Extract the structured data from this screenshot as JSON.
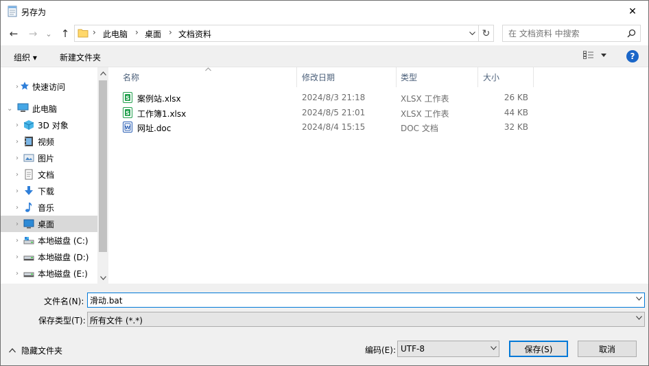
{
  "window": {
    "title": "另存为",
    "close_glyph": "✕"
  },
  "nav": {
    "back_glyph": "←",
    "forward_glyph": "→",
    "recent_glyph": "⌄",
    "up_glyph": "↑",
    "breadcrumb": [
      "此电脑",
      "桌面",
      "文档资料"
    ],
    "breadcrumb_sep": "›",
    "refresh_glyph": "↻",
    "search_placeholder": "在 文档资料 中搜索"
  },
  "toolbar": {
    "organize": "组织 ▾",
    "new_folder": "新建文件夹",
    "help": "?"
  },
  "sidebar": {
    "items": [
      {
        "label": "快速访问",
        "icon": "star-icon"
      },
      {
        "label": "此电脑",
        "icon": "pc-icon"
      },
      {
        "label": "3D 对象",
        "icon": "3d-objects-icon"
      },
      {
        "label": "视频",
        "icon": "video-icon"
      },
      {
        "label": "图片",
        "icon": "pictures-icon"
      },
      {
        "label": "文档",
        "icon": "documents-icon"
      },
      {
        "label": "下载",
        "icon": "download-icon"
      },
      {
        "label": "音乐",
        "icon": "music-icon"
      },
      {
        "label": "桌面",
        "icon": "desktop-icon"
      },
      {
        "label": "本地磁盘 (C:)",
        "icon": "drive-c-icon"
      },
      {
        "label": "本地磁盘 (D:)",
        "icon": "drive-icon"
      },
      {
        "label": "本地磁盘 (E:)",
        "icon": "drive-icon"
      }
    ],
    "selected": "桌面"
  },
  "columns": [
    "名称",
    "修改日期",
    "类型",
    "大小"
  ],
  "files": [
    {
      "name": "案例站.xlsx",
      "date": "2024/8/3 21:18",
      "type": "XLSX 工作表",
      "size": "26 KB",
      "icon": "xlsx-file-icon"
    },
    {
      "name": "工作簿1.xlsx",
      "date": "2024/8/5 21:01",
      "type": "XLSX 工作表",
      "size": "44 KB",
      "icon": "xlsx-file-icon"
    },
    {
      "name": "网址.doc",
      "date": "2024/8/4 15:15",
      "type": "DOC 文档",
      "size": "32 KB",
      "icon": "doc-file-icon"
    }
  ],
  "bottom": {
    "filename_label": "文件名(N):",
    "filename_value": "滑动.bat",
    "filetype_label": "保存类型(T):",
    "filetype_value": "所有文件 (*.*)",
    "hide_folders": "隐藏文件夹",
    "encoding_label": "编码(E):",
    "encoding_value": "UTF-8",
    "save": "保存(S)",
    "cancel": "取消"
  }
}
